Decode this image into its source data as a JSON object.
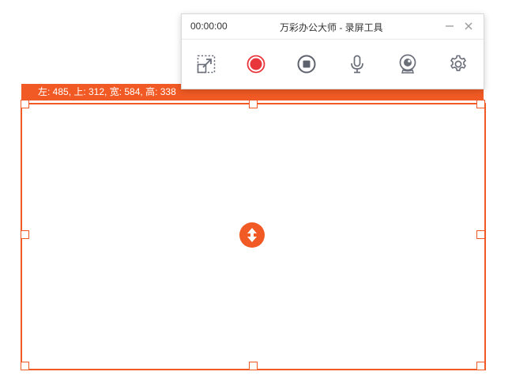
{
  "toolbar": {
    "timer": "00:00:00",
    "title": "万彩办公大师 - 录屏工具",
    "icons": [
      "select-region-icon",
      "record-icon",
      "stop-icon",
      "microphone-icon",
      "webcam-icon",
      "settings-icon"
    ]
  },
  "region": {
    "info": "左: 485, 上: 312, 宽: 584, 高: 338"
  },
  "colors": {
    "accent": "#f15a24",
    "record": "#e8363c",
    "icon": "#6b6f7a"
  }
}
